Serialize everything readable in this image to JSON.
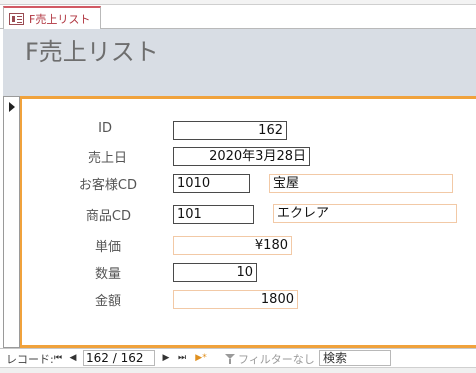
{
  "tab": {
    "label": "F売上リスト",
    "icon": "form-icon"
  },
  "header": {
    "title": "F売上リスト"
  },
  "fields": {
    "id": {
      "label": "ID",
      "value": "162"
    },
    "sale_date": {
      "label": "売上日",
      "value": "2020年3月28日"
    },
    "customer_cd": {
      "label": "お客様CD",
      "value": "1010",
      "name": "宝屋"
    },
    "product_cd": {
      "label": "商品CD",
      "value": "101",
      "name": "エクレア"
    },
    "unit_price": {
      "label": "単価",
      "value": "¥180"
    },
    "quantity": {
      "label": "数量",
      "value": "10"
    },
    "amount": {
      "label": "金額",
      "value": "1800"
    }
  },
  "navigation": {
    "label": "レコード:",
    "first": "⏮",
    "prev": "◀",
    "record": "162 / 162",
    "next": "▶",
    "last": "⏭",
    "new": "▶*",
    "filter_label": "フィルターなし",
    "search_label": "検索"
  },
  "colors": {
    "accent": "#f0a23c",
    "tab_accent": "#d25a64",
    "header_bg": "#d8dde4",
    "light_border": "#f2c9a6"
  }
}
